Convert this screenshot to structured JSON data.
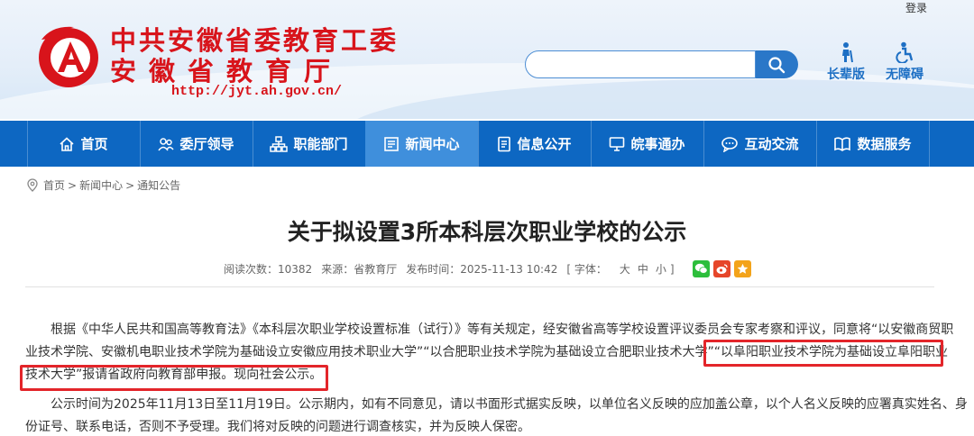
{
  "header": {
    "login": "登录",
    "title_line1": "中共安徽省委教育工委",
    "title_line2": "安徽省教育厅",
    "url": "http://jyt.ah.gov.cn/",
    "search_placeholder": "",
    "tools": [
      {
        "label": "长辈版",
        "icon": "elder-icon"
      },
      {
        "label": "无障碍",
        "icon": "accessibility-icon"
      }
    ]
  },
  "nav": {
    "items": [
      {
        "label": "首页",
        "icon": "home-icon"
      },
      {
        "label": "委厅领导",
        "icon": "people-icon"
      },
      {
        "label": "职能部门",
        "icon": "org-chart-icon"
      },
      {
        "label": "新闻中心",
        "icon": "news-icon",
        "active": true
      },
      {
        "label": "信息公开",
        "icon": "document-icon"
      },
      {
        "label": "皖事通办",
        "icon": "monitor-icon"
      },
      {
        "label": "互动交流",
        "icon": "chat-icon"
      },
      {
        "label": "数据服务",
        "icon": "book-icon"
      }
    ]
  },
  "breadcrumb": {
    "items": [
      "首页",
      "新闻中心",
      "通知公告"
    ],
    "sep": ">"
  },
  "article": {
    "title": "关于拟设置3所本科层次职业学校的公示",
    "meta": {
      "views": "阅读次数：10382",
      "source": "来源：省教育厅",
      "time": "发布时间：2025-11-13 10:42",
      "font_prefix": "[ 字体：",
      "font_large": "大",
      "font_medium": "中",
      "font_small": "小",
      "font_suffix": "]"
    },
    "share": [
      {
        "name": "wechat-icon",
        "color": "#2dbe3c"
      },
      {
        "name": "weibo-icon",
        "color": "#e6462a"
      },
      {
        "name": "favorite-icon",
        "color": "#f3a31a"
      }
    ],
    "para1_lines": [
      "　　根据《中华人民共和国高等教育法》《本科层次职业学校设置标准（试行）》等有关规定，经安徽省高等学校设置评议委员会专家考察和评议，同意将“以安徽商贸职",
      "业技术学院、安徽机电职业技术学院为基础设立安徽应用技术职业大学”“以合肥职业技术学院为基础设立合肥职业技术大学”“以阜阳职业技术学院为基础设立阜阳职业",
      "技术大学”报请省政府向教育部申报。现向社会公示。"
    ],
    "para2_lines": [
      "　　公示时间为2025年11月13日至11月19日。公示期内，如有不同意见，请以书面形式据实反映，以单位名义反映的应加盖公章，以个人名义反映的应署真实姓名、身",
      "份证号、联系电话，否则不予受理。我们将对反映的问题进行调查核实，并为反映人保密。"
    ],
    "highlight_color": "#e3252a"
  },
  "colors": {
    "brand_red": "#d8141b",
    "nav_blue": "#0d67c2",
    "nav_active": "#3f8fdc"
  }
}
